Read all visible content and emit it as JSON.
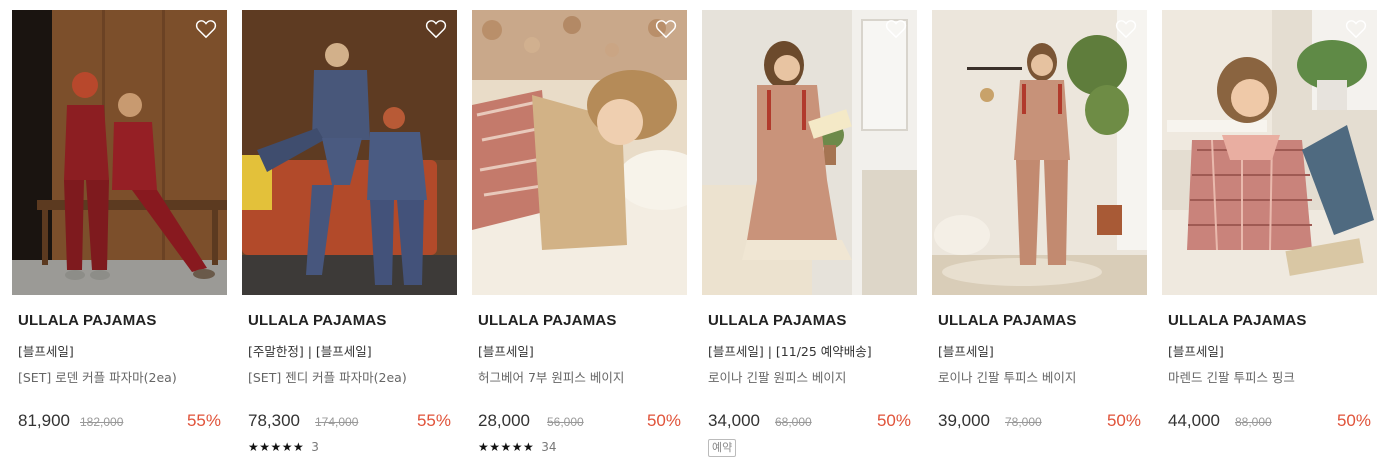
{
  "products": [
    {
      "brand": "ULLALA PAJAMAS",
      "tags": "[블프세일]",
      "name": "[SET] 로덴 커플 파자마(2ea)",
      "price": "81,900",
      "original_price": "182,000",
      "discount": "55%",
      "stars": "",
      "review_count": "",
      "badge": ""
    },
    {
      "brand": "ULLALA PAJAMAS",
      "tags": "[주말한정] | [블프세일]",
      "name": "[SET] 젠디 커플 파자마(2ea)",
      "price": "78,300",
      "original_price": "174,000",
      "discount": "55%",
      "stars": "★★★★★",
      "review_count": "3",
      "badge": ""
    },
    {
      "brand": "ULLALA PAJAMAS",
      "tags": "[블프세일]",
      "name": "허그베어 7부 원피스 베이지",
      "price": "28,000",
      "original_price": "56,000",
      "discount": "50%",
      "stars": "★★★★★",
      "review_count": "34",
      "badge": ""
    },
    {
      "brand": "ULLALA PAJAMAS",
      "tags": "[블프세일] | [11/25 예약배송]",
      "name": "로이나 긴팔 원피스 베이지",
      "price": "34,000",
      "original_price": "68,000",
      "discount": "50%",
      "stars": "",
      "review_count": "",
      "badge": "예약"
    },
    {
      "brand": "ULLALA PAJAMAS",
      "tags": "[블프세일]",
      "name": "로이나 긴팔 투피스 베이지",
      "price": "39,000",
      "original_price": "78,000",
      "discount": "50%",
      "stars": "",
      "review_count": "",
      "badge": ""
    },
    {
      "brand": "ULLALA PAJAMAS",
      "tags": "[블프세일]",
      "name": "마렌드 긴팔 투피스 핑크",
      "price": "44,000",
      "original_price": "88,000",
      "discount": "50%",
      "stars": "",
      "review_count": "",
      "badge": ""
    }
  ],
  "icons": {
    "wishlist": "heart-outline-icon",
    "rating": "star-icon"
  },
  "colors": {
    "discount": "#e0533a",
    "text": "#222222",
    "muted": "#999999"
  }
}
